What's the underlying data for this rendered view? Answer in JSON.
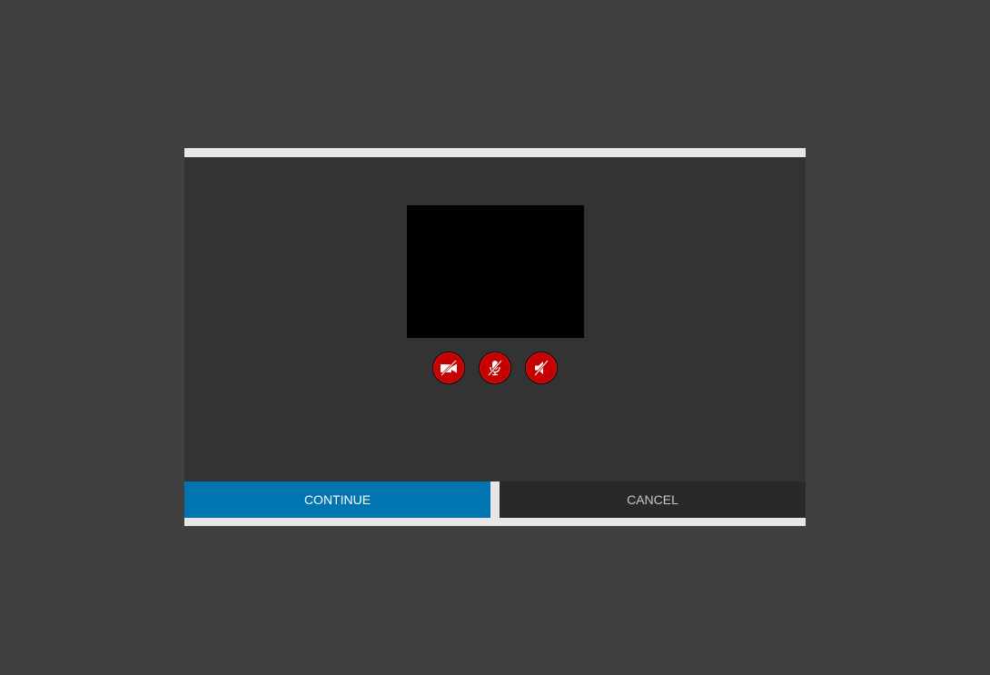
{
  "dialog": {
    "controls": [
      {
        "icon": "camera-off-icon",
        "state": "off"
      },
      {
        "icon": "microphone-off-icon",
        "state": "off"
      },
      {
        "icon": "speaker-off-icon",
        "state": "off"
      }
    ],
    "buttons": {
      "continue_label": "CONTINUE",
      "cancel_label": "CANCEL"
    }
  },
  "colors": {
    "background": "#404040",
    "panel": "#333333",
    "frame": "#e6e6e6",
    "video": "#000000",
    "control_red": "#c40000",
    "continue_blue": "#0075b0",
    "cancel_dark": "#292929"
  }
}
